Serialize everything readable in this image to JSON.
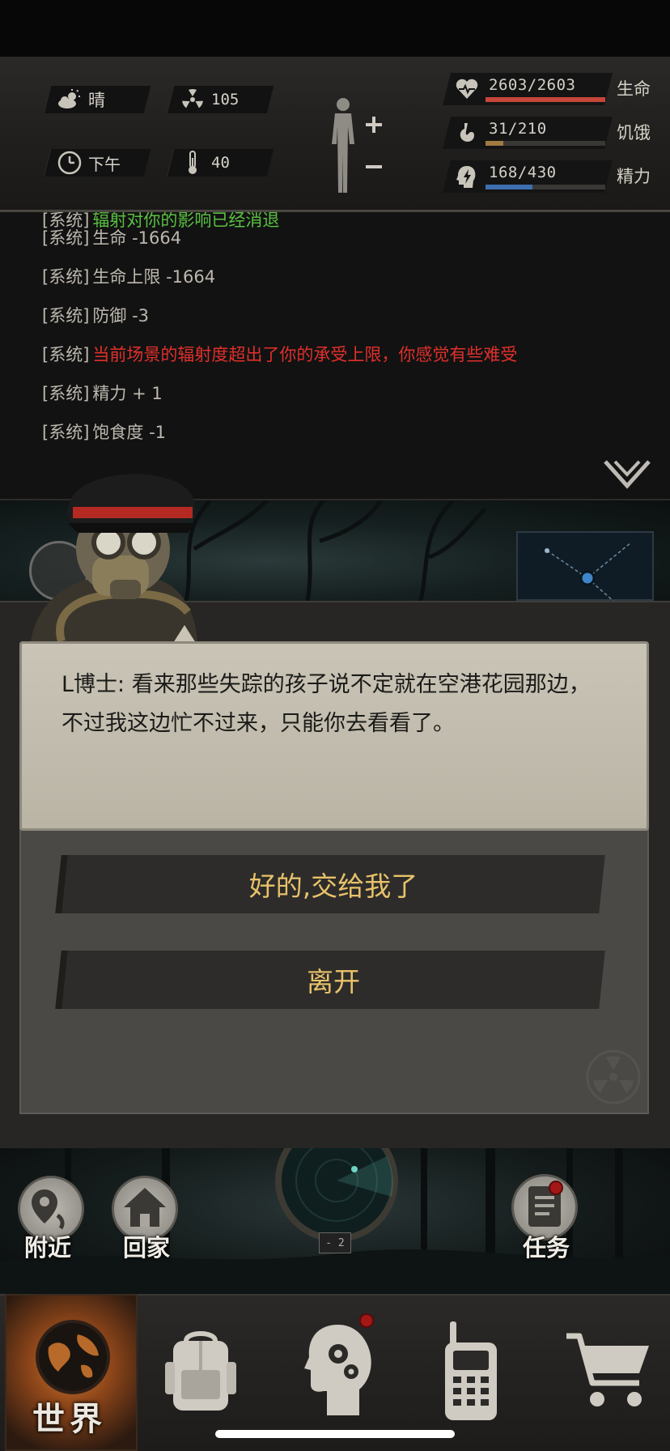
{
  "stats": {
    "weather": "晴",
    "radiation": "105",
    "time_of_day": "下午",
    "temperature": "40",
    "health": {
      "value": "2603/2603",
      "label": "生命",
      "fraction": 1.0,
      "color": "#c6473a"
    },
    "hunger": {
      "value": "31/210",
      "label": "饥饿",
      "fraction": 0.148,
      "color": "#a07a42"
    },
    "energy": {
      "value": "168/430",
      "label": "精力",
      "fraction": 0.39,
      "color": "#3d6fb0"
    }
  },
  "log": [
    {
      "tag": "[系统]",
      "msg": "辐射对你的影响已经消退",
      "style": "green"
    },
    {
      "tag": "[系统]",
      "msg": "生命 -1664",
      "style": "normal"
    },
    {
      "tag": "[系统]",
      "msg": "生命上限 -1664",
      "style": "normal"
    },
    {
      "tag": "[系统]",
      "msg": "防御 -3",
      "style": "normal"
    },
    {
      "tag": "[系统]",
      "msg": "当前场景的辐射度超出了你的承受上限，你感觉有些难受",
      "style": "red"
    },
    {
      "tag": "[系统]",
      "msg": "精力 + 1",
      "style": "normal"
    },
    {
      "tag": "[系统]",
      "msg": "饱食度 -1",
      "style": "normal"
    }
  ],
  "dialog": {
    "text": "L博士: 看来那些失踪的孩子说不定就在空港花园那边，不过我这边忙不过来，只能你去看看了。",
    "choices": [
      "好的,交给我了",
      "离开"
    ]
  },
  "actions": {
    "nearby": "附近",
    "home": "回家",
    "tasks": "任务",
    "radar_level": "- 2"
  },
  "nav": {
    "world": "世界"
  }
}
